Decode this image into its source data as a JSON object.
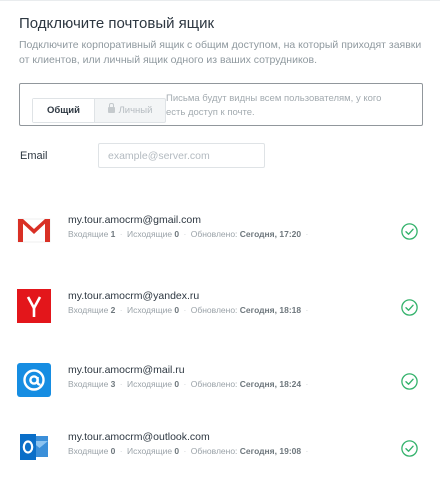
{
  "header": {
    "title": "Подключите почтовый ящик",
    "subtitle": "Подключите корпоративный ящик с общим доступом, на который приходят заявки от клиентов, или личный ящик одного из ваших сотрудников."
  },
  "access": {
    "general_label": "Общий",
    "personal_label": "Личный",
    "selected": "general",
    "hint": "Письма будут видны всем пользователям, у кого есть доступ к почте."
  },
  "email_form": {
    "label": "Email",
    "placeholder": "example@server.com",
    "value": ""
  },
  "meta_labels": {
    "incoming": "Входящие",
    "outgoing": "Исходящие",
    "updated": "Обновлено:",
    "separator": "·"
  },
  "mailboxes": [
    {
      "address": "my.tour.amocrm@gmail.com",
      "incoming": "1",
      "outgoing": "0",
      "updated": "Сегодня, 17:20",
      "provider_icon": "gmail-icon",
      "connected": true
    },
    {
      "address": "my.tour.amocrm@yandex.ru",
      "incoming": "2",
      "outgoing": "0",
      "updated": "Сегодня, 18:18",
      "provider_icon": "yandex-icon",
      "connected": true
    },
    {
      "address": "my.tour.amocrm@mail.ru",
      "incoming": "3",
      "outgoing": "0",
      "updated": "Сегодня, 18:24",
      "provider_icon": "mailru-icon",
      "connected": true
    },
    {
      "address": "my.tour.amocrm@outlook.com",
      "incoming": "0",
      "outgoing": "0",
      "updated": "Сегодня, 19:08",
      "provider_icon": "outlook-icon",
      "connected": true
    }
  ],
  "colors": {
    "gmail": "#d93025",
    "yandex": "#e3161b",
    "mailru": "#168de2",
    "outlook": "#0a6ec8",
    "check": "#33b26b"
  }
}
